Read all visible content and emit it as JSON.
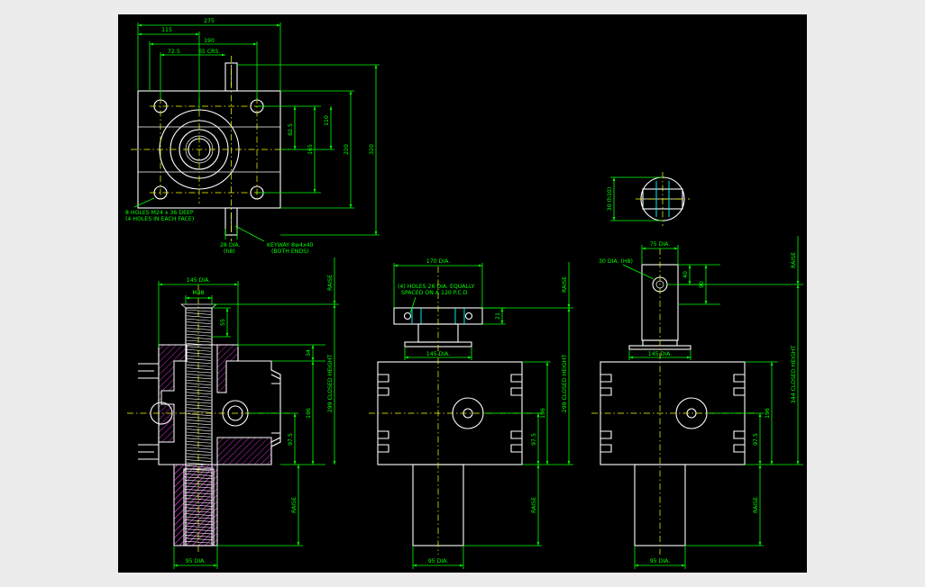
{
  "colors": {
    "background": "#000000",
    "geometry": "#ffffff",
    "dimension": "#00ff00",
    "centerline": "#ffff00",
    "hidden": "#00ffff",
    "hatch": "#ff40ff"
  },
  "top_view": {
    "dim_275": "275",
    "dim_115": "115",
    "dim_190": "190",
    "dim_725": "72.5",
    "dim_65crs": "65 CRS.",
    "dim_825": "82.5",
    "dim_110": "110",
    "dim_165": "165",
    "dim_220": "220",
    "dim_320": "320",
    "note_holes_1": "8 HOLES M24 x 36 DEEP",
    "note_holes_2": "(4 HOLES IN EACH FACE)",
    "note_dia_1": "28 DIA.",
    "note_dia_2": "(h8)",
    "note_keyway_1": "KEYWAY 8w4x40",
    "note_keyway_2": "(BOTH ENDS)"
  },
  "shaft_end": {
    "dim_30_h10": "30 (h10)"
  },
  "section_view": {
    "dim_145dia": "145 DIA.",
    "dim_m48": "M48",
    "dim_55": "55",
    "dim_34": "34",
    "dim_196": "196",
    "dim_975": "97.5",
    "raise_top": "RAISE",
    "closed_height": "299 CLOSED HEIGHT",
    "raise_bottom": "RAISE",
    "dim_95dia": "95 DIA."
  },
  "flange_view": {
    "dim_170dia": "170 DIA.",
    "note_holes_1": "(4) HOLES 26 DIA. EQUALLY",
    "note_holes_2": "SPACED ON A 120 P.C.D",
    "dim_21": "21",
    "dim_145dia": "145 DIA.",
    "raise_top": "RAISE",
    "closed_height": "299 CLOSED HEIGHT",
    "dim_196": "196",
    "dim_975": "97.5",
    "raise_bottom": "RAISE",
    "dim_95dia": "95 DIA."
  },
  "clevis_view": {
    "dim_75dia": "75 DIA.",
    "dim_30dia": "30 DIA. (H8)",
    "dim_40": "40",
    "dim_90": "90",
    "dim_145dia": "145 DIA.",
    "raise_top": "RAISE",
    "closed_height": "344 CLOSED HEIGHT",
    "dim_196": "196",
    "dim_975": "97.5",
    "raise_bottom": "RAISE",
    "dim_95dia": "95 DIA."
  }
}
